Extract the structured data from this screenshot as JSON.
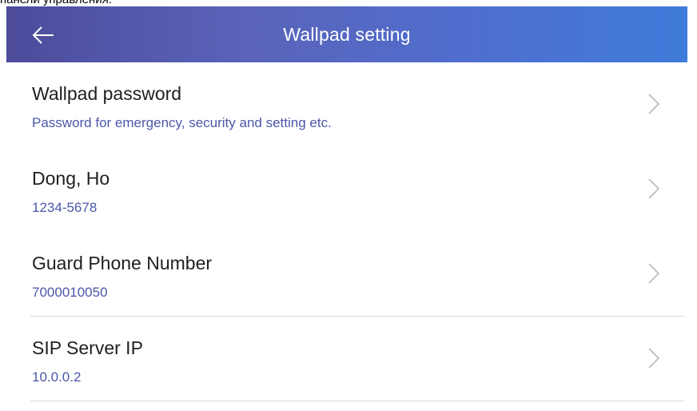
{
  "top_caption": "панели управления.",
  "header": {
    "title": "Wallpad setting",
    "back_icon": "arrow-left-icon",
    "gradient_colors": [
      "#4d4b9a",
      "#5a63b9",
      "#4f6fd0",
      "#3f7cdb"
    ]
  },
  "settings": {
    "items": [
      {
        "title": "Wallpad password",
        "subtitle": "Password for emergency, security and setting etc.",
        "icon": "chevron-right-icon"
      },
      {
        "title": "Dong, Ho",
        "subtitle": "1234-5678",
        "icon": "chevron-right-icon"
      },
      {
        "title": "Guard Phone Number",
        "subtitle": "7000010050",
        "icon": "chevron-right-icon"
      },
      {
        "title": "SIP Server IP",
        "subtitle": "10.0.0.2",
        "icon": "chevron-right-icon"
      }
    ]
  },
  "colors": {
    "subtitle_accent": "#4b57a8",
    "title_text": "#1f1f1f",
    "divider": "#d9d9d9"
  }
}
